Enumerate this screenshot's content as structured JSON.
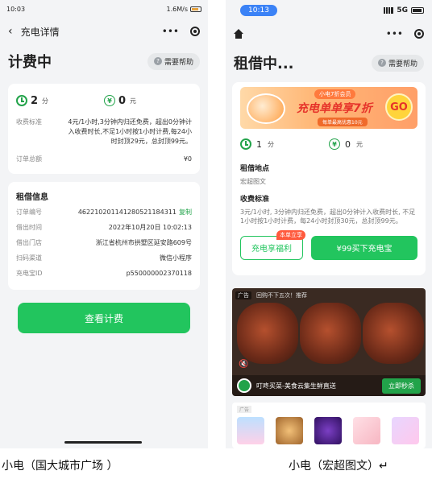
{
  "left": {
    "status": {
      "time": "10:03",
      "speed": "1.6M/s",
      "battery_color": "#e6a23c"
    },
    "nav": {
      "back_glyph": "‹",
      "title": "充电详情",
      "more_glyph": "•••"
    },
    "header": {
      "title": "计费中",
      "help_label": "需要帮助",
      "help_glyph": "?"
    },
    "stats": {
      "duration_value": "2",
      "duration_unit": "分",
      "fee_value": "0",
      "fee_unit": "元",
      "yen_glyph": "¥"
    },
    "fee_rows": [
      {
        "key": "收费标准",
        "value": "4元/1小时,3分钟内归还免费，超出0分钟计入收费时长,不足1小时按1小时计费,每24小时封顶29元，总封顶99元。"
      },
      {
        "key": "订单总额",
        "value": "¥0"
      }
    ],
    "rental": {
      "title": "租借信息",
      "rows": [
        {
          "key": "订单编号",
          "value": "46221020114128052118431​1",
          "link": "复制"
        },
        {
          "key": "借出时间",
          "value": "2022年10月20日 10:02:13"
        },
        {
          "key": "借出门店",
          "value": "浙江省杭州市拱墅区延安路609号"
        },
        {
          "key": "扫码渠道",
          "value": "微信小程序"
        },
        {
          "key": "充电宝ID",
          "value": "p550000002370118"
        }
      ]
    },
    "button_label": "查看计费",
    "accent": "#22c55e"
  },
  "right": {
    "status": {
      "time": "10:13",
      "network": "5G"
    },
    "nav": {
      "more_glyph": "•••"
    },
    "header": {
      "title": "租借中...",
      "help_label": "需要帮助",
      "help_glyph": "?"
    },
    "banner": {
      "tag": "小电7折会员",
      "main": "充电单单享7折",
      "sub": "每单最高优惠10元",
      "go": "GO"
    },
    "stats": {
      "duration_value": "1",
      "duration_unit": "分",
      "fee_value": "0",
      "fee_unit": "元",
      "yen_glyph": "¥"
    },
    "location_label": "租借地点",
    "location_value": "宏超图文",
    "fee_label": "收费标准",
    "fee_value": "3元/1小时, 3分钟内归还免费，超出0分钟计入收费时长, 不足1小时按1小时计费，每24小时封顶30元，总封顶99元。",
    "benefit_button": "充电享福利",
    "benefit_badge": "本单立享",
    "buy_button": "¥99买下充电宝",
    "ad": {
      "ad_tag": "广告",
      "top_text": "回购不下五次！推荐",
      "caption": "叮咚买菜-美食云集生鲜直送",
      "cta": "立即秒杀",
      "mute_glyph": "🔇"
    },
    "ad2": {
      "ad_tag": "广告"
    }
  },
  "captions": {
    "left": "小电（国大城市广场 ）",
    "right": "小电（宏超图文）↵"
  }
}
